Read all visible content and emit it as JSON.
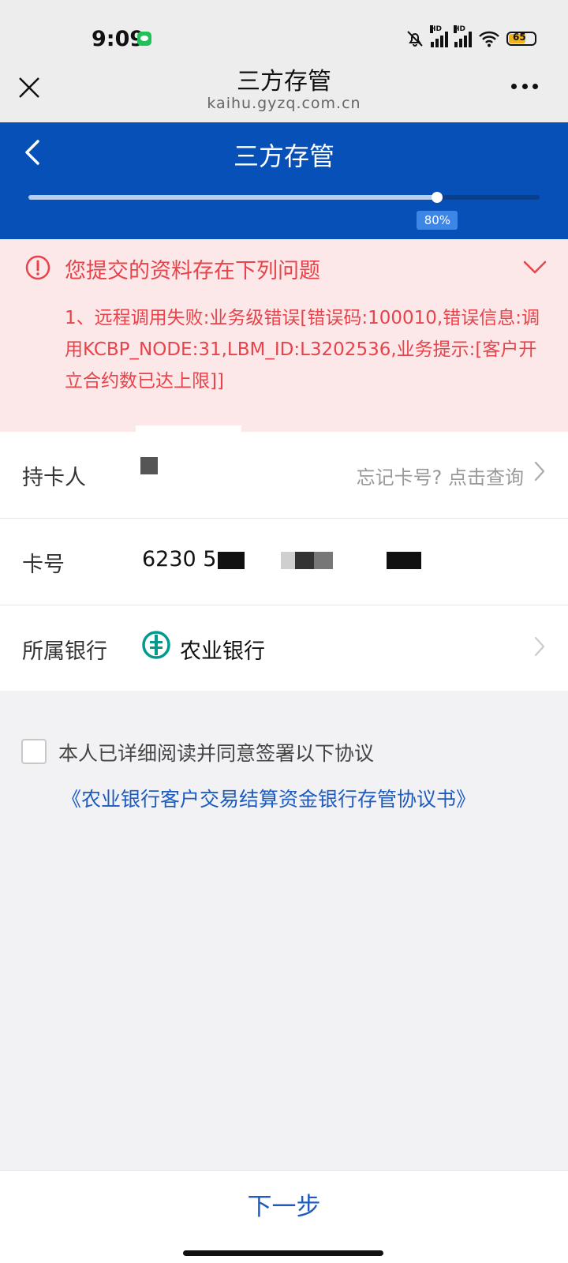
{
  "status_bar": {
    "time": "9:09",
    "battery": "65"
  },
  "webview": {
    "title": "三方存管",
    "url": "kaihu.gyzq.com.cn"
  },
  "header": {
    "title": "三方存管",
    "progress": 0.8,
    "progress_label": "80%"
  },
  "error": {
    "title": "您提交的资料存在下列问题",
    "message": "1、远程调用失败:业务级错误[错误码:100010,错误信息:调用KCBP_NODE:31,LBM_ID:L3202536,业务提示:[客户开立合约数已达上限]]"
  },
  "form": {
    "holder": {
      "label": "持卡人",
      "hint": "忘记卡号?  点击查询"
    },
    "card": {
      "label": "卡号",
      "value": "6230 5"
    },
    "bank": {
      "label": "所属银行",
      "value": "农业银行"
    }
  },
  "agreement": {
    "text": "本人已详细阅读并同意签署以下协议",
    "link": "《农业银行客户交易结算资金银行存管协议书》"
  },
  "footer": {
    "next_label": "下一步"
  },
  "colors": {
    "brand_blue": "#0650b8",
    "error_red": "#e8434a",
    "link_blue": "#1d5bbf",
    "bank_green": "#009a8e"
  }
}
